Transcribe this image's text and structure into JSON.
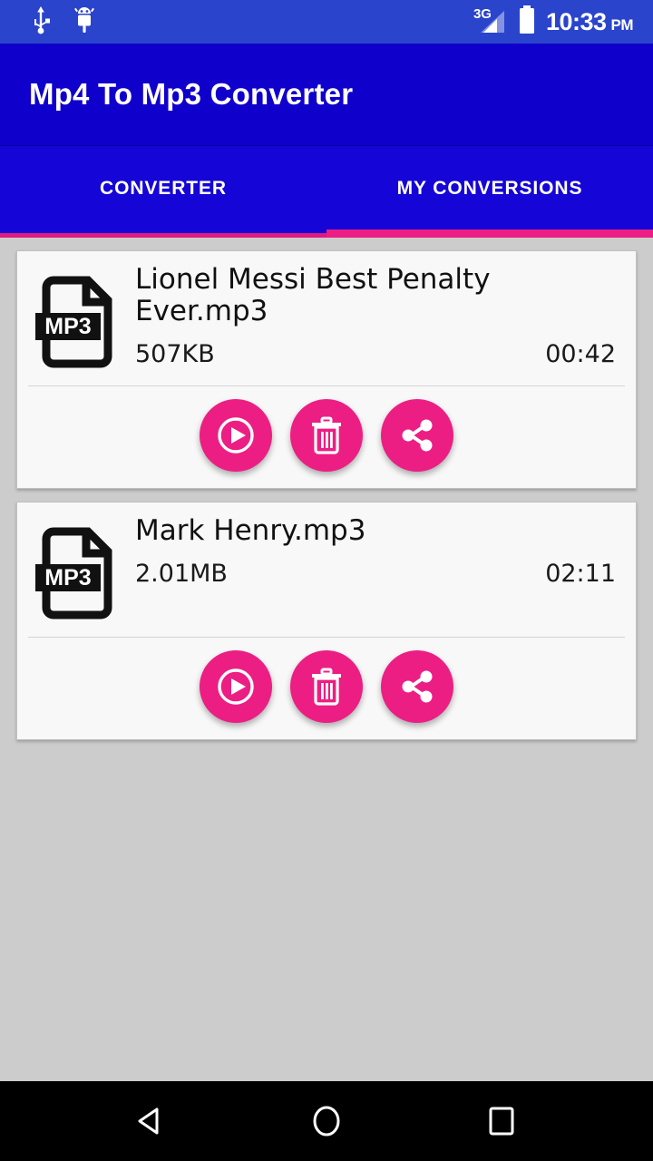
{
  "status_bar": {
    "usb_icon": "usb-icon",
    "android_debug_icon": "android-debug-icon",
    "network_type": "3G",
    "signal_icon": "signal-bars-icon",
    "battery_icon": "battery-full-icon",
    "time": "10:33",
    "ampm": "PM",
    "background_color": "#2a44cc"
  },
  "app_bar": {
    "title": "Mp4 To Mp3 Converter",
    "background_color": "#0f00cc"
  },
  "tabs": {
    "items": [
      {
        "label": "CONVERTER",
        "selected": false
      },
      {
        "label": "MY CONVERSIONS",
        "selected": true
      }
    ],
    "indicator_color": "#ec1e84"
  },
  "conversions": {
    "items": [
      {
        "file_icon": "mp3-file-icon",
        "file_icon_label": "MP3",
        "name": "Lionel Messi Best Penalty Ever.mp3",
        "size": "507KB",
        "duration": "00:42",
        "actions": [
          {
            "name": "play-button",
            "icon": "play-circle-icon"
          },
          {
            "name": "delete-button",
            "icon": "trash-icon"
          },
          {
            "name": "share-button",
            "icon": "share-icon"
          }
        ]
      },
      {
        "file_icon": "mp3-file-icon",
        "file_icon_label": "MP3",
        "name": "Mark Henry.mp3",
        "size": "2.01MB",
        "duration": "02:11",
        "actions": [
          {
            "name": "play-button",
            "icon": "play-circle-icon"
          },
          {
            "name": "delete-button",
            "icon": "trash-icon"
          },
          {
            "name": "share-button",
            "icon": "share-icon"
          }
        ]
      }
    ]
  },
  "nav_bar": {
    "back_icon": "back-triangle-icon",
    "home_icon": "home-circle-icon",
    "recents_icon": "recents-square-icon",
    "background_color": "#000000"
  },
  "colors": {
    "accent_pink": "#ec1e84",
    "primary_blue": "#0f00cc",
    "page_background": "#cccccc",
    "card_background": "#f8f8f8"
  }
}
